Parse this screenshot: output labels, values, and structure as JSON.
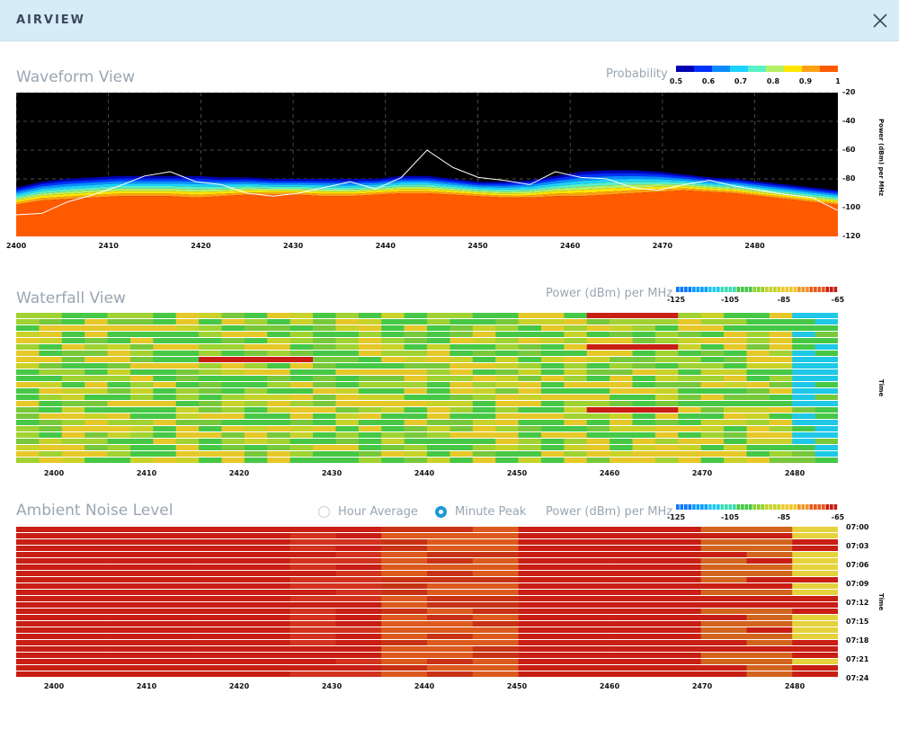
{
  "dialog": {
    "title": "AIRVIEW"
  },
  "waveform": {
    "title": "Waveform View",
    "legend_label": "Probability",
    "legend_ticks": [
      "0.5",
      "0.6",
      "0.7",
      "0.8",
      "0.9",
      "1"
    ],
    "legend_colors": [
      "#0000b4",
      "#0032ff",
      "#0a8cff",
      "#1ed2ff",
      "#5af0c8",
      "#b4f064",
      "#ffe600",
      "#ffa014",
      "#ff5a00"
    ],
    "y_label": "Power (dBm) per MHz",
    "chart_data": {
      "type": "area",
      "x_ticks": [
        "2400",
        "2410",
        "2420",
        "2430",
        "2440",
        "2450",
        "2460",
        "2470",
        "2480"
      ],
      "y_ticks": [
        "-20",
        "-40",
        "-60",
        "-80",
        "-100",
        "-120"
      ],
      "xlim": [
        2400,
        2489
      ],
      "ylim": [
        -120,
        -20
      ],
      "orange_top": [
        -98,
        -95,
        -94,
        -93,
        -92,
        -92,
        -92,
        -93,
        -92,
        -91,
        -91,
        -91,
        -92,
        -92,
        -91,
        -90,
        -90,
        -91,
        -92,
        -93,
        -93,
        -92,
        -92,
        -91,
        -90,
        -89,
        -88,
        -89,
        -90,
        -92,
        -94,
        -96,
        -98
      ],
      "blue_top": [
        -86,
        -82,
        -80,
        -79,
        -78,
        -78,
        -78,
        -78,
        -79,
        -79,
        -80,
        -80,
        -80,
        -80,
        -80,
        -78,
        -78,
        -80,
        -82,
        -82,
        -81,
        -78,
        -75,
        -74,
        -74,
        -75,
        -77,
        -79,
        -80,
        -82,
        -84,
        -86,
        -88
      ],
      "max_line": [
        -105,
        -104,
        -96,
        -91,
        -85,
        -78,
        -75,
        -82,
        -84,
        -90,
        -92,
        -90,
        -86,
        -82,
        -87,
        -79,
        -60,
        -72,
        -79,
        -81,
        -84,
        -75,
        -79,
        -80,
        -86,
        -88,
        -84,
        -81,
        -85,
        -88,
        -91,
        -93,
        -102
      ]
    }
  },
  "waterfall": {
    "title": "Waterfall View",
    "legend_label": "Power (dBm) per MHz",
    "legend_ticks": [
      "-125",
      "-105",
      "-85",
      "-65"
    ],
    "time_label": "Time",
    "x_ticks": [
      "2400",
      "2410",
      "2420",
      "2430",
      "2440",
      "2450",
      "2460",
      "2470",
      "2480"
    ]
  },
  "ambient": {
    "title": "Ambient Noise Level",
    "radio_hour": "Hour Average",
    "radio_minute": "Minute Peak",
    "selected": "Minute Peak",
    "legend_label": "Power (dBm) per MHz",
    "legend_ticks": [
      "-125",
      "-105",
      "-85",
      "-65"
    ],
    "time_label": "Time",
    "time_ticks": [
      "07:00",
      "07:03",
      "07:06",
      "07:09",
      "07:12",
      "07:15",
      "07:18",
      "07:21",
      "07:24"
    ],
    "x_ticks": [
      "2400",
      "2410",
      "2420",
      "2430",
      "2440",
      "2450",
      "2460",
      "2470",
      "2480"
    ]
  }
}
